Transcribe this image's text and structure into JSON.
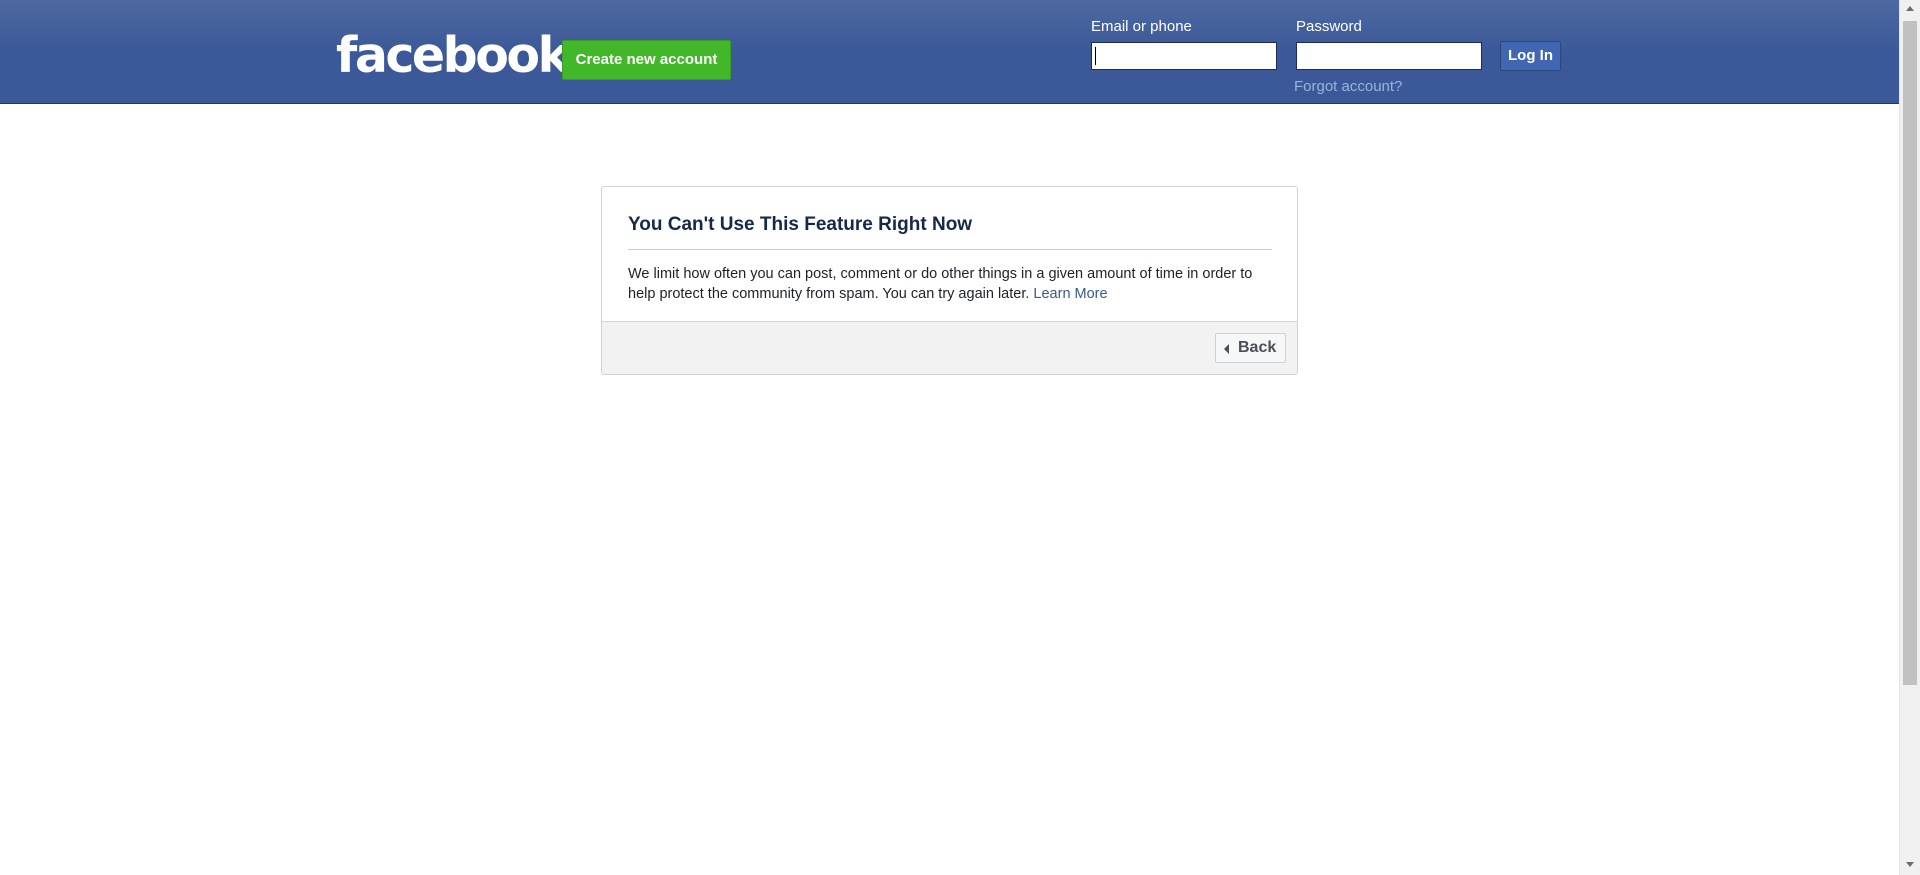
{
  "header": {
    "logo_text": "facebook",
    "create_account_label": "Create new account",
    "email_label": "Email or phone",
    "email_value": "",
    "password_label": "Password",
    "password_value": "",
    "login_label": "Log In",
    "forgot_label": "Forgot account?"
  },
  "dialog": {
    "title": "You Can't Use This Feature Right Now",
    "body": "We limit how often you can post, comment or do other things in a given amount of time in order to help protect the community from spam. You can try again later.",
    "learn_more_label": "Learn More",
    "back_label": "Back"
  },
  "colors": {
    "header_bg": "#3b5998",
    "create_button": "#42b72a",
    "login_button": "#4267b2",
    "link": "#385898",
    "footer_bg": "#f2f2f2"
  },
  "icons": {
    "back": "caret-left-icon",
    "scroll_up": "arrow-up-icon",
    "scroll_down": "arrow-down-icon"
  }
}
